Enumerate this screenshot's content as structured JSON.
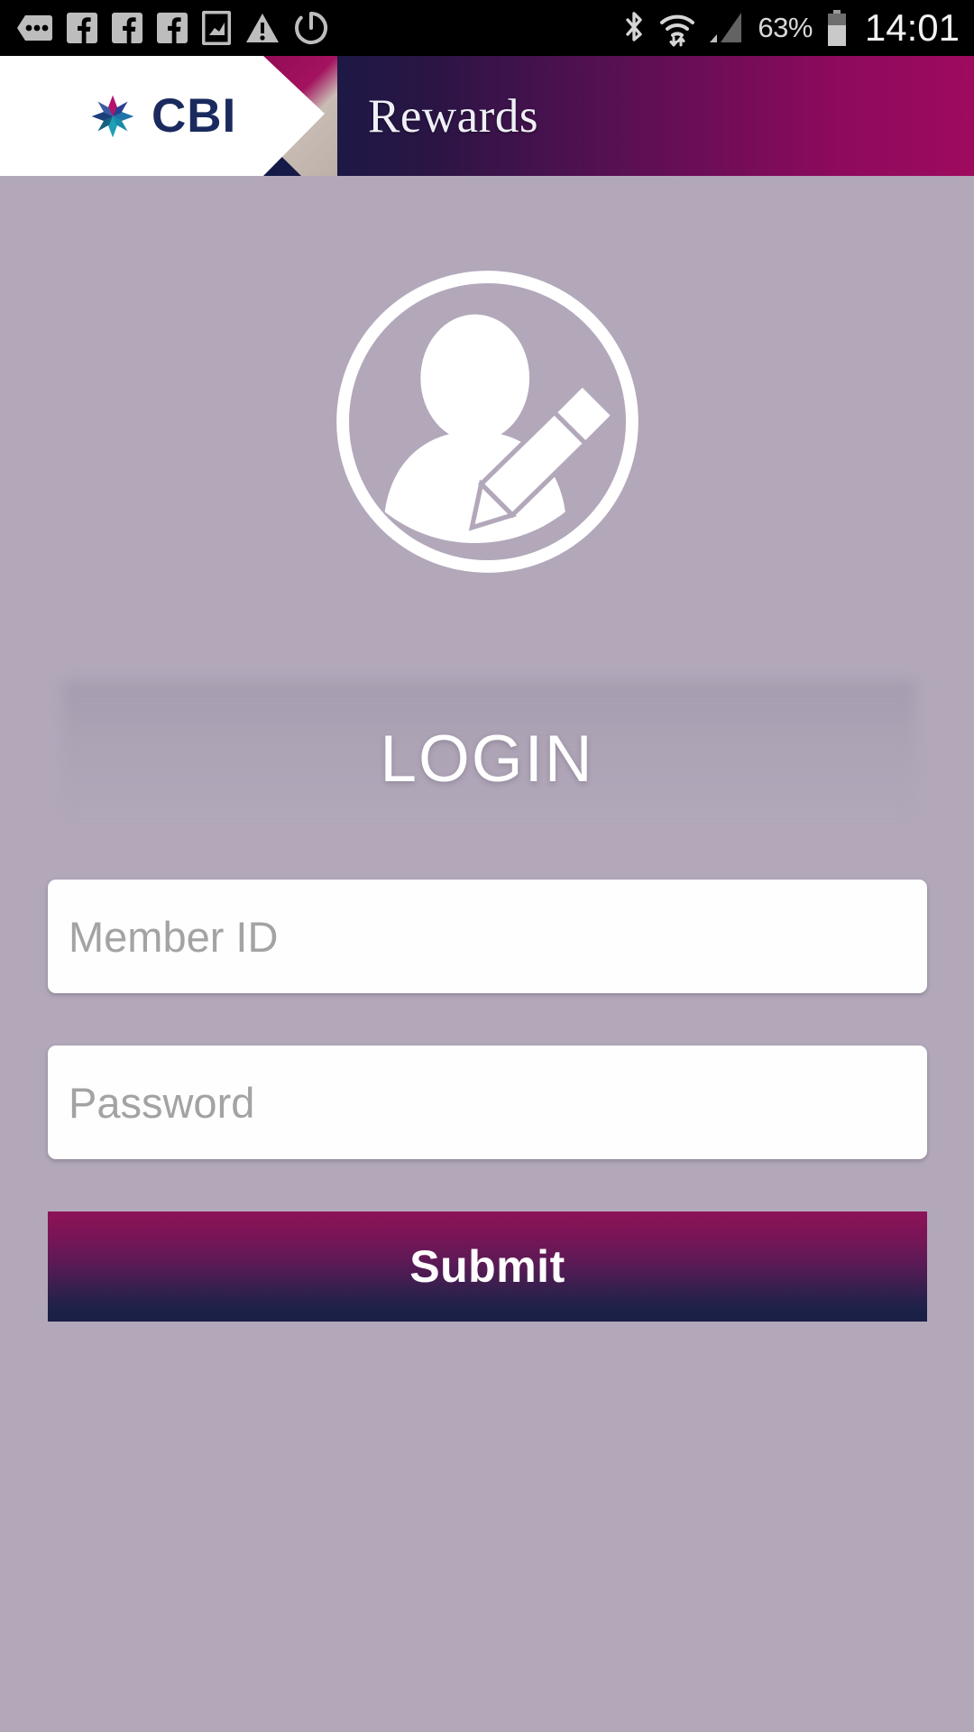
{
  "statusbar": {
    "battery_percent": "63%",
    "clock": "14:01",
    "left_icons": [
      {
        "name": "messaging-icon"
      },
      {
        "name": "facebook-icon"
      },
      {
        "name": "facebook-icon"
      },
      {
        "name": "facebook-icon"
      },
      {
        "name": "screenshot-icon"
      },
      {
        "name": "warning-icon"
      },
      {
        "name": "alarm-icon"
      }
    ],
    "right_icons": [
      {
        "name": "bluetooth-icon"
      },
      {
        "name": "wifi-icon"
      },
      {
        "name": "signal-icon"
      },
      {
        "name": "battery-icon"
      }
    ]
  },
  "header": {
    "brand": "CBI",
    "title": "Rewards",
    "logo_icon": "cbi-starburst-logo",
    "colors": {
      "navy": "#0a1a3f",
      "magenta": "#9e0a5e",
      "brand_text": "#1b2a5e"
    }
  },
  "login": {
    "avatar_icon": "user-edit-avatar-icon",
    "heading": "LOGIN",
    "member_id": {
      "placeholder": "Member ID",
      "value": ""
    },
    "password": {
      "placeholder": "Password",
      "value": ""
    },
    "submit_label": "Submit"
  },
  "colors": {
    "page_background": "#b2a8ba",
    "field_background": "#fefefe",
    "placeholder_text": "#a3a3a3",
    "submit_top": "#8d1256",
    "submit_bottom": "#1a1f45"
  }
}
